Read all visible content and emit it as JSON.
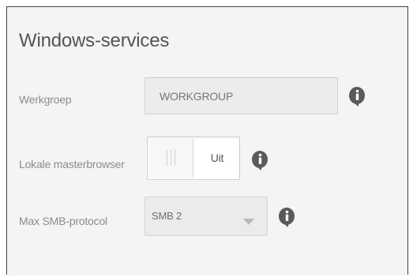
{
  "section": {
    "title": "Windows-services"
  },
  "workgroup": {
    "label": "Werkgroep",
    "value": "WORKGROUP"
  },
  "local_master_browser": {
    "label": "Lokale masterbrowser",
    "state": "Uit",
    "enabled": false
  },
  "max_smb_protocol": {
    "label": "Max SMB-protocol",
    "selected": "SMB 2"
  },
  "icons": {
    "info": "info-icon"
  },
  "colors": {
    "panel_background": "#f4f4f4",
    "label_text": "#8c8c8c",
    "title_text": "#555555",
    "info_icon": "#5a5a5a"
  }
}
